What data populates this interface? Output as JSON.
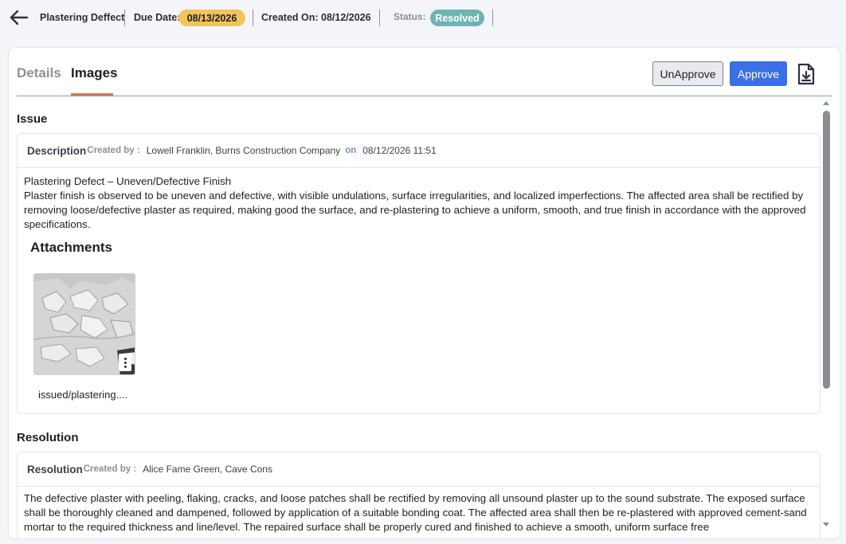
{
  "header": {
    "title": "Plastering Deffect",
    "due_label": "Due Date:",
    "due_value": "08/13/2026",
    "created_label": "Created On: 08/12/2026",
    "status_label": "Status:",
    "status_value": "Resolved"
  },
  "tabs": [
    {
      "label": "Details",
      "active": false
    },
    {
      "label": "Images",
      "active": true
    }
  ],
  "actions": {
    "unapprove_label": "UnApprove",
    "approve_label": "Approve"
  },
  "issue": {
    "section_title": "Issue",
    "panel_title": "Description",
    "created_by_label": "Created by :",
    "created_by_value": "Lowell Franklin, Burns Construction Company",
    "on_label": "on",
    "on_value": "08/12/2026 11:51",
    "heading": "Plastering Defect – Uneven/Defective Finish",
    "text": "Plaster finish is observed to be uneven and defective, with visible undulations, surface irregularities, and localized imperfections. The affected area shall be rectified by removing loose/defective plaster as required, making good the surface, and re-plastering to achieve a uniform, smooth, and true finish in accordance with the approved specifications.",
    "attachments_title": "Attachments",
    "attachment_name": "issued/plastering...."
  },
  "resolution": {
    "section_title": "Resolution",
    "panel_title": "Resolution",
    "created_by_label": "Created by :",
    "created_by_value": "Alice Fame Green, Cave Cons",
    "text": "The defective plaster with peeling, flaking, cracks, and loose patches shall be rectified by removing all unsound plaster up to the sound substrate. The exposed surface shall be thoroughly cleaned and dampened, followed by application of a suitable bonding coat. The affected area shall then be re-plastered with approved cement-sand mortar to the required thickness and line/level. The repaired surface shall be properly cured and finished to achieve a smooth, uniform surface free"
  },
  "colors": {
    "due_pill": "#f3c35b",
    "status_pill": "#6fb3b3",
    "approve_button": "#3b6fe8",
    "tab_underline": "#e0764a"
  },
  "icons": {
    "back": "arrow-left-icon",
    "download": "file-download-icon",
    "kebab": "more-vertical-icon"
  }
}
